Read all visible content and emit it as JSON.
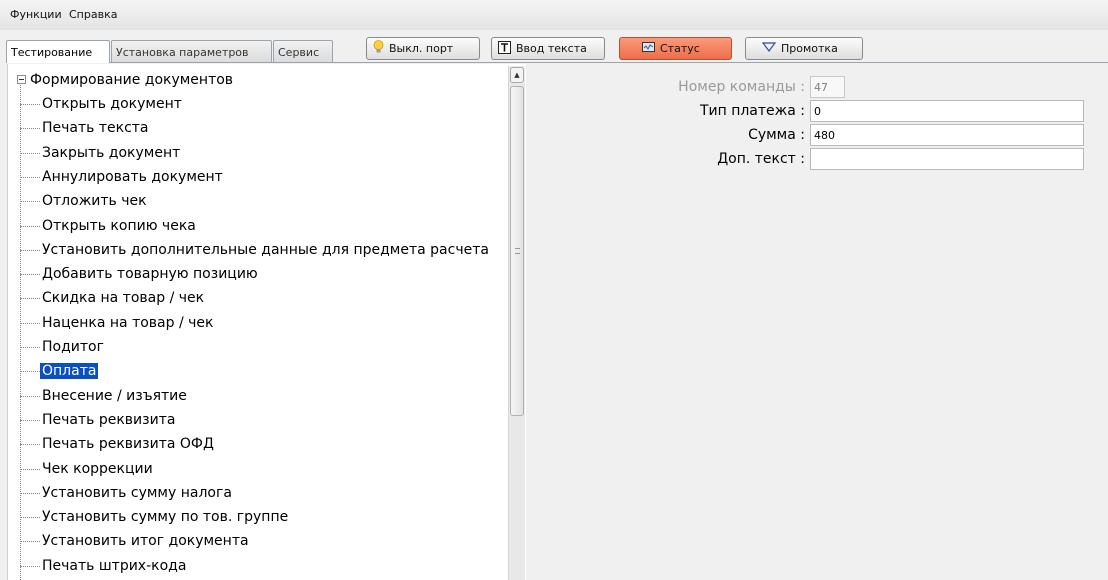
{
  "menu": {
    "functions": "Функции",
    "help": "Справка"
  },
  "tabs": {
    "testing": "Тестирование",
    "parameters": "Установка параметров",
    "service": "Сервис"
  },
  "toolbar": {
    "port_off": "Выкл. порт",
    "text_input": "Ввод текста",
    "status": "Статус",
    "scroll": "Промотка"
  },
  "tree": {
    "root": "Формирование документов",
    "items": [
      "Открыть документ",
      "Печать текста",
      "Закрыть документ",
      "Аннулировать документ",
      "Отложить чек",
      "Открыть копию чека",
      "Установить дополнительные данные для предмета расчета",
      "Добавить товарную позицию",
      "Скидка на товар / чек",
      "Наценка на товар / чек",
      "Подитог",
      "Оплата",
      "Внесение / изъятие",
      "Печать реквизита",
      "Печать реквизита ОФД",
      "Чек коррекции",
      "Установить сумму налога",
      "Установить сумму по тов. группе",
      "Установить итог документа",
      "Печать штрих-кода"
    ],
    "selected": "Оплата"
  },
  "form": {
    "command_number_label": "Номер команды :",
    "command_number_value": "47",
    "payment_type_label": "Тип платежа :",
    "payment_type_value": "0",
    "sum_label": "Сумма :",
    "sum_value": "480",
    "extra_text_label": "Доп. текст :",
    "extra_text_value": ""
  },
  "colors": {
    "selection": "#0a50c0",
    "status_button": "#f07e5c"
  }
}
